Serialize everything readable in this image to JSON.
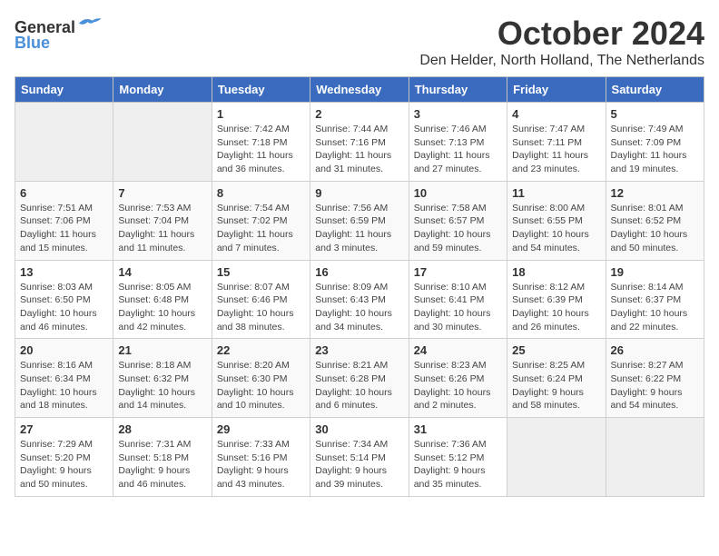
{
  "logo": {
    "general": "General",
    "blue": "Blue"
  },
  "title": "October 2024",
  "location": "Den Helder, North Holland, The Netherlands",
  "days_header": [
    "Sunday",
    "Monday",
    "Tuesday",
    "Wednesday",
    "Thursday",
    "Friday",
    "Saturday"
  ],
  "weeks": [
    [
      {
        "day": "",
        "info": ""
      },
      {
        "day": "",
        "info": ""
      },
      {
        "day": "1",
        "info": "Sunrise: 7:42 AM\nSunset: 7:18 PM\nDaylight: 11 hours\nand 36 minutes."
      },
      {
        "day": "2",
        "info": "Sunrise: 7:44 AM\nSunset: 7:16 PM\nDaylight: 11 hours\nand 31 minutes."
      },
      {
        "day": "3",
        "info": "Sunrise: 7:46 AM\nSunset: 7:13 PM\nDaylight: 11 hours\nand 27 minutes."
      },
      {
        "day": "4",
        "info": "Sunrise: 7:47 AM\nSunset: 7:11 PM\nDaylight: 11 hours\nand 23 minutes."
      },
      {
        "day": "5",
        "info": "Sunrise: 7:49 AM\nSunset: 7:09 PM\nDaylight: 11 hours\nand 19 minutes."
      }
    ],
    [
      {
        "day": "6",
        "info": "Sunrise: 7:51 AM\nSunset: 7:06 PM\nDaylight: 11 hours\nand 15 minutes."
      },
      {
        "day": "7",
        "info": "Sunrise: 7:53 AM\nSunset: 7:04 PM\nDaylight: 11 hours\nand 11 minutes."
      },
      {
        "day": "8",
        "info": "Sunrise: 7:54 AM\nSunset: 7:02 PM\nDaylight: 11 hours\nand 7 minutes."
      },
      {
        "day": "9",
        "info": "Sunrise: 7:56 AM\nSunset: 6:59 PM\nDaylight: 11 hours\nand 3 minutes."
      },
      {
        "day": "10",
        "info": "Sunrise: 7:58 AM\nSunset: 6:57 PM\nDaylight: 10 hours\nand 59 minutes."
      },
      {
        "day": "11",
        "info": "Sunrise: 8:00 AM\nSunset: 6:55 PM\nDaylight: 10 hours\nand 54 minutes."
      },
      {
        "day": "12",
        "info": "Sunrise: 8:01 AM\nSunset: 6:52 PM\nDaylight: 10 hours\nand 50 minutes."
      }
    ],
    [
      {
        "day": "13",
        "info": "Sunrise: 8:03 AM\nSunset: 6:50 PM\nDaylight: 10 hours\nand 46 minutes."
      },
      {
        "day": "14",
        "info": "Sunrise: 8:05 AM\nSunset: 6:48 PM\nDaylight: 10 hours\nand 42 minutes."
      },
      {
        "day": "15",
        "info": "Sunrise: 8:07 AM\nSunset: 6:46 PM\nDaylight: 10 hours\nand 38 minutes."
      },
      {
        "day": "16",
        "info": "Sunrise: 8:09 AM\nSunset: 6:43 PM\nDaylight: 10 hours\nand 34 minutes."
      },
      {
        "day": "17",
        "info": "Sunrise: 8:10 AM\nSunset: 6:41 PM\nDaylight: 10 hours\nand 30 minutes."
      },
      {
        "day": "18",
        "info": "Sunrise: 8:12 AM\nSunset: 6:39 PM\nDaylight: 10 hours\nand 26 minutes."
      },
      {
        "day": "19",
        "info": "Sunrise: 8:14 AM\nSunset: 6:37 PM\nDaylight: 10 hours\nand 22 minutes."
      }
    ],
    [
      {
        "day": "20",
        "info": "Sunrise: 8:16 AM\nSunset: 6:34 PM\nDaylight: 10 hours\nand 18 minutes."
      },
      {
        "day": "21",
        "info": "Sunrise: 8:18 AM\nSunset: 6:32 PM\nDaylight: 10 hours\nand 14 minutes."
      },
      {
        "day": "22",
        "info": "Sunrise: 8:20 AM\nSunset: 6:30 PM\nDaylight: 10 hours\nand 10 minutes."
      },
      {
        "day": "23",
        "info": "Sunrise: 8:21 AM\nSunset: 6:28 PM\nDaylight: 10 hours\nand 6 minutes."
      },
      {
        "day": "24",
        "info": "Sunrise: 8:23 AM\nSunset: 6:26 PM\nDaylight: 10 hours\nand 2 minutes."
      },
      {
        "day": "25",
        "info": "Sunrise: 8:25 AM\nSunset: 6:24 PM\nDaylight: 9 hours\nand 58 minutes."
      },
      {
        "day": "26",
        "info": "Sunrise: 8:27 AM\nSunset: 6:22 PM\nDaylight: 9 hours\nand 54 minutes."
      }
    ],
    [
      {
        "day": "27",
        "info": "Sunrise: 7:29 AM\nSunset: 5:20 PM\nDaylight: 9 hours\nand 50 minutes."
      },
      {
        "day": "28",
        "info": "Sunrise: 7:31 AM\nSunset: 5:18 PM\nDaylight: 9 hours\nand 46 minutes."
      },
      {
        "day": "29",
        "info": "Sunrise: 7:33 AM\nSunset: 5:16 PM\nDaylight: 9 hours\nand 43 minutes."
      },
      {
        "day": "30",
        "info": "Sunrise: 7:34 AM\nSunset: 5:14 PM\nDaylight: 9 hours\nand 39 minutes."
      },
      {
        "day": "31",
        "info": "Sunrise: 7:36 AM\nSunset: 5:12 PM\nDaylight: 9 hours\nand 35 minutes."
      },
      {
        "day": "",
        "info": ""
      },
      {
        "day": "",
        "info": ""
      }
    ]
  ]
}
